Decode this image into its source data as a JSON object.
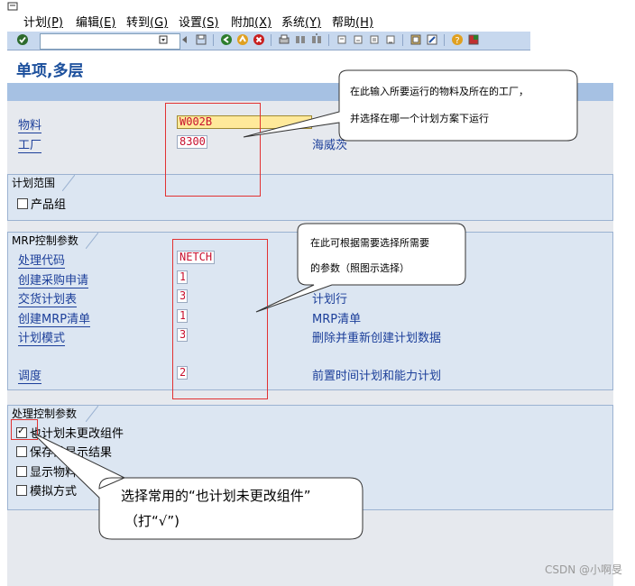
{
  "menu": {
    "items": [
      {
        "label": "计划",
        "key": "(P)"
      },
      {
        "label": "编辑",
        "key": "(E)"
      },
      {
        "label": "转到",
        "key": "(G)"
      },
      {
        "label": "设置",
        "key": "(S)"
      },
      {
        "label": "附加",
        "key": "(X)"
      },
      {
        "label": "系统",
        "key": "(Y)"
      },
      {
        "label": "帮助",
        "key": "(H)"
      }
    ]
  },
  "toolbar": {
    "command_value": ""
  },
  "page": {
    "title": "单项,多层"
  },
  "header_fields": {
    "material": {
      "label": "物料",
      "value": "W002B"
    },
    "plant": {
      "label": "工厂",
      "value": "8300",
      "desc": "海威茨"
    }
  },
  "group_scope": {
    "title": "计划范围",
    "product_group": "产品组"
  },
  "group_mrp": {
    "title": "MRP控制参数",
    "rows": [
      {
        "label": "处理代码",
        "value": "NETCH",
        "desc": ""
      },
      {
        "label": "创建采购申请",
        "value": "1",
        "desc": ""
      },
      {
        "label": "交货计划表",
        "value": "3",
        "desc": "计划行"
      },
      {
        "label": "创建MRP清单",
        "value": "1",
        "desc": "MRP清单"
      },
      {
        "label": "计划模式",
        "value": "3",
        "desc": "删除并重新创建计划数据"
      },
      {
        "label": "调度",
        "value": "2",
        "desc": "前置时间计划和能力计划"
      }
    ]
  },
  "group_process": {
    "title": "处理控制参数",
    "options": [
      {
        "label": "也计划未更改组件",
        "checked": true
      },
      {
        "label": "保存前显示结果",
        "checked": false
      },
      {
        "label": "显示物料清单",
        "checked": false
      },
      {
        "label": "模拟方式",
        "checked": false
      }
    ]
  },
  "callouts": {
    "c1": {
      "line1": "在此输入所要运行的物料及所在的工厂，",
      "line2": "并选择在哪一个计划方案下运行"
    },
    "c2": {
      "line1": "在此可根据需要选择所需要",
      "line2": "的参数（照图示选择）"
    },
    "c3": {
      "line1": "选择常用的“也计划未更改组件”",
      "line2": "（打“√”)"
    }
  },
  "watermark": "CSDN @小啊旻"
}
